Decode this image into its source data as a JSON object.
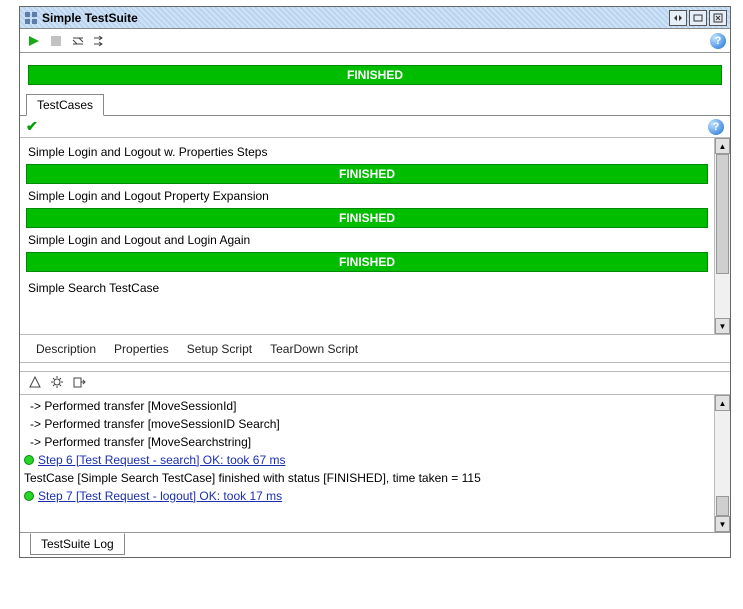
{
  "window": {
    "title": "Simple TestSuite"
  },
  "overall_status": "FINISHED",
  "tabs": {
    "testcases": "TestCases"
  },
  "testcases": [
    {
      "name": "Simple Login and Logout w. Properties Steps",
      "status": "FINISHED"
    },
    {
      "name": "Simple Login and Logout Property Expansion",
      "status": "FINISHED"
    },
    {
      "name": "Simple Login and Logout and Login Again",
      "status": "FINISHED"
    },
    {
      "name": "Simple Search TestCase",
      "status": ""
    }
  ],
  "subtabs": {
    "description": "Description",
    "properties": "Properties",
    "setup": "Setup Script",
    "teardown": "TearDown Script"
  },
  "log": {
    "lines": [
      {
        "indent": true,
        "text": "-> Performed transfer [MoveSessionId]"
      },
      {
        "indent": true,
        "text": "-> Performed transfer [moveSessionID Search]"
      },
      {
        "indent": true,
        "text": "-> Performed transfer [MoveSearchstring]"
      },
      {
        "ok": true,
        "link": "Step 6 [Test Request - search] OK: took 67 ms"
      },
      {
        "text": "TestCase [Simple Search TestCase] finished with status [FINISHED], time taken = 115"
      },
      {
        "ok": true,
        "link": "Step 7 [Test Request - logout] OK: took 17 ms"
      }
    ],
    "tab_label": "TestSuite Log"
  }
}
